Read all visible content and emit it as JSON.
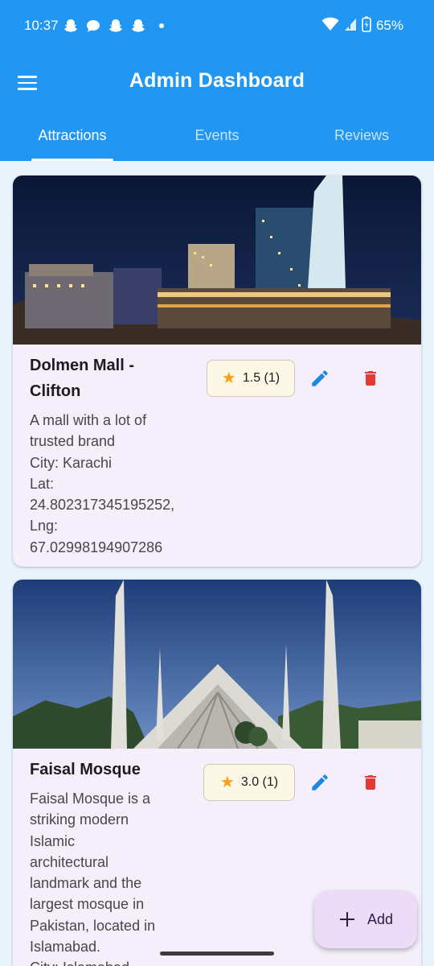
{
  "status_bar": {
    "time": "10:37",
    "battery": "65%",
    "notification_icons": [
      "snapchat-icon",
      "chat-icon",
      "snapchat-icon",
      "snapchat-icon"
    ]
  },
  "app_bar": {
    "title": "Admin Dashboard",
    "menu_icon": "menu-icon"
  },
  "tabs": [
    {
      "label": "Attractions",
      "active": true
    },
    {
      "label": "Events",
      "active": false
    },
    {
      "label": "Reviews",
      "active": false
    }
  ],
  "attractions": [
    {
      "title_lines": [
        "Dolmen Mall -",
        "Clifton"
      ],
      "description_lines": [
        "A mall with a lot of",
        "trusted brand"
      ],
      "city": "City: Karachi",
      "lat_label": "Lat:",
      "lat_value": "24.802317345195252,",
      "lng_label": "Lng:",
      "lng_value": "67.02998194907286",
      "rating": "1.5 (1)",
      "image": "mall-night-photo"
    },
    {
      "title_lines": [
        "Faisal Mosque"
      ],
      "description_lines": [
        "Faisal Mosque is a",
        "striking modern",
        "Islamic",
        "architectural",
        "landmark and the",
        "largest mosque in",
        "Pakistan, located in",
        "Islamabad."
      ],
      "city": "City: Islamabad",
      "rating": "3.0 (1)",
      "image": "mosque-photo"
    }
  ],
  "fab": {
    "label": "Add",
    "icon": "plus-icon"
  },
  "colors": {
    "primary": "#2196f3",
    "card_bg": "#f4effa",
    "delete": "#e53935",
    "edit": "#1e88e5",
    "star": "#f7a116",
    "fab_bg": "#ecdcf7"
  }
}
